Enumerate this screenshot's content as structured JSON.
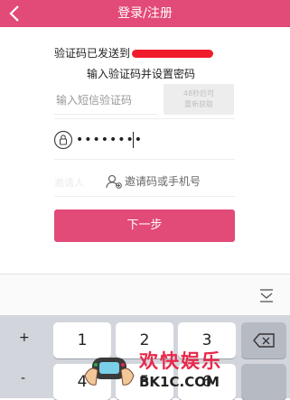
{
  "header": {
    "title": "登录/注册"
  },
  "verify": {
    "sent_text": "验证码已发送到",
    "set_password_text": "输入验证码并设置密码",
    "code_placeholder": "输入短信验证码",
    "resend_line1": "48秒后可",
    "resend_line2": "重新获取"
  },
  "password": {
    "value": "••••••••"
  },
  "invite": {
    "label": "邀请人",
    "placeholder": "邀请码或手机号"
  },
  "next_button": {
    "label": "下一步"
  },
  "keyboard": {
    "row1": {
      "sym": "+",
      "keys": [
        "1",
        "2",
        "3"
      ]
    },
    "row2": {
      "sym": "-",
      "keys": [
        "4",
        "5",
        "6"
      ]
    }
  },
  "watermark": {
    "title": "欢快娱乐",
    "site": "BK1C.COM"
  },
  "colors": {
    "accent": "#e24a78",
    "redaction": "#f01c2c",
    "keyboard_bg": "#d2d5db"
  },
  "icons": [
    "back-chevron-icon",
    "lock-icon",
    "user-add-icon",
    "hide-keyboard-icon",
    "backspace-icon"
  ]
}
